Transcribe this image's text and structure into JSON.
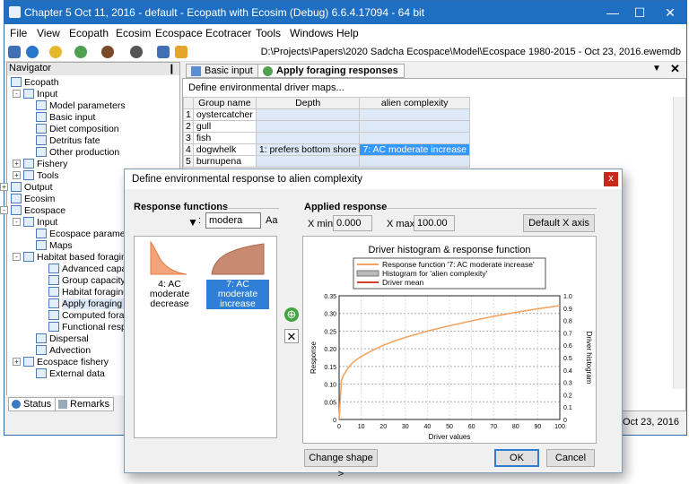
{
  "window": {
    "title": "Chapter 5 Oct 11, 2016 - default - Ecopath with Ecosim (Debug) 6.6.4.17094 - 64 bit"
  },
  "menu": [
    "File",
    "View",
    "Ecopath",
    "Ecosim",
    "Ecospace",
    "Ecotracer",
    "Tools",
    "Windows",
    "Help"
  ],
  "toolbar": {
    "path": "D:\\Projects\\Papers\\2020 Sadcha Ecospace\\Model\\Ecospace 1980-2015 - Oct 23, 2016.ewemdb"
  },
  "navigator": {
    "title": "Navigator",
    "pin": "❙",
    "items": [
      {
        "label": "Ecopath"
      },
      {
        "label": "Input"
      },
      {
        "label": "Model parameters"
      },
      {
        "label": "Basic input"
      },
      {
        "label": "Diet composition"
      },
      {
        "label": "Detritus fate"
      },
      {
        "label": "Other production"
      },
      {
        "label": "Fishery"
      },
      {
        "label": "Tools"
      },
      {
        "label": "Output"
      },
      {
        "label": "Ecosim"
      },
      {
        "label": "Ecospace"
      },
      {
        "label": "Input"
      },
      {
        "label": "Ecospace parameters"
      },
      {
        "label": "Maps"
      },
      {
        "label": "Habitat based foraging"
      },
      {
        "label": "Advanced capacity p"
      },
      {
        "label": "Group capacity mode"
      },
      {
        "label": "Habitat foraging usa"
      },
      {
        "label": "Apply foraging respo"
      },
      {
        "label": "Computed foraging c"
      },
      {
        "label": "Functional responses"
      },
      {
        "label": "Dispersal"
      },
      {
        "label": "Advection"
      },
      {
        "label": "Ecospace fishery"
      },
      {
        "label": "External data"
      }
    ],
    "tabs": [
      "Status",
      "Remarks"
    ]
  },
  "doc": {
    "tabs": [
      "Basic input",
      "Apply foraging responses"
    ],
    "subtitle": "Define environmental driver maps...",
    "columns": [
      "Group name",
      "Depth",
      "alien complexity"
    ],
    "rows": [
      {
        "n": "1",
        "name": "oystercatcher",
        "depth": "",
        "alien": ""
      },
      {
        "n": "2",
        "name": "gull",
        "depth": "",
        "alien": ""
      },
      {
        "n": "3",
        "name": "fish",
        "depth": "",
        "alien": ""
      },
      {
        "n": "4",
        "name": "dogwhelk",
        "depth": "1: prefers bottom shore",
        "alien": "7: AC moderate  increase"
      },
      {
        "n": "5",
        "name": "burnupena",
        "depth": "",
        "alien": ""
      }
    ]
  },
  "status": {
    "date": "- Oct 23, 2016"
  },
  "dialog": {
    "title": "Define environmental response to alien complexity",
    "close": "x",
    "response_functions_label": "Response functions",
    "filter_value": "modera",
    "filter_sep": ":",
    "case_label": "Aa",
    "functions": [
      {
        "label": "4: AC moderate decrease",
        "selected": false
      },
      {
        "label": "7: AC moderate increase",
        "selected": true
      }
    ],
    "applied_label": "Applied response",
    "xmin_label": "X min:",
    "xmin": "0.000",
    "xmax_label": "X max:",
    "xmax": "100.00",
    "default_x_axis": "Default X axis",
    "change_shape": "Change shape >",
    "ok": "OK",
    "cancel": "Cancel",
    "add_icon": "⊕",
    "remove_icon": "✕"
  },
  "chart_data": {
    "type": "line",
    "title": "Driver histogram & response function",
    "legend": [
      "Response function '7: AC moderate  increase'",
      "Histogram for 'alien complexity'",
      "Driver mean"
    ],
    "xlabel": "Driver values",
    "ylabel": "Response",
    "y2label": "Driver histogram",
    "xlim": [
      0,
      100
    ],
    "ylim": [
      0,
      0.35
    ],
    "y2lim": [
      0,
      1.0
    ],
    "xticks": [
      0,
      10,
      20,
      30,
      40,
      50,
      60,
      70,
      80,
      90,
      100
    ],
    "yticks": [
      0,
      0.05,
      0.1,
      0.15,
      0.2,
      0.25,
      0.3,
      0.35
    ],
    "y2ticks": [
      0,
      0.1,
      0.2,
      0.3,
      0.4,
      0.5,
      0.6,
      0.7,
      0.8,
      0.9,
      1.0
    ],
    "xtick_labels": [
      "0",
      "10",
      "20",
      "30",
      "40",
      "50",
      "60",
      "70",
      "80",
      "90",
      "100"
    ],
    "ytick_labels": [
      "0",
      "0.05",
      "0.10",
      "0.15",
      "0.20",
      "0.25",
      "0.30",
      "0.35"
    ],
    "y2tick_labels": [
      "0",
      "0.1",
      "0.2",
      "0.3",
      "0.4",
      "0.5",
      "0.6",
      "0.7",
      "0.8",
      "0.9",
      "1.0"
    ],
    "series": [
      {
        "name": "Response function '7: AC moderate  increase'",
        "x": [
          0,
          1,
          2,
          4,
          6,
          8,
          10,
          15,
          20,
          25,
          30,
          40,
          50,
          60,
          70,
          80,
          90,
          100
        ],
        "y": [
          0.0,
          0.11,
          0.125,
          0.145,
          0.16,
          0.17,
          0.178,
          0.195,
          0.21,
          0.222,
          0.232,
          0.25,
          0.265,
          0.279,
          0.292,
          0.303,
          0.313,
          0.322
        ]
      }
    ],
    "grid": true,
    "legend_position": "top"
  }
}
